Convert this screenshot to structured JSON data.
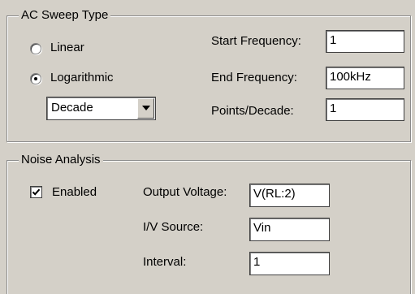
{
  "ac_sweep": {
    "title": "AC Sweep Type",
    "linear_label": "Linear",
    "logarithmic_label": "Logarithmic",
    "selected": "Logarithmic",
    "scale_value": "Decade",
    "start_frequency_label": "Start Frequency:",
    "start_frequency_value": "1",
    "end_frequency_label": "End Frequency:",
    "end_frequency_value": "100kHz",
    "points_label": "Points/Decade:",
    "points_value": "1"
  },
  "noise": {
    "title": "Noise Analysis",
    "enabled_label": "Enabled",
    "enabled_checked": true,
    "output_voltage_label": "Output Voltage:",
    "output_voltage_value": "V(RL:2)",
    "source_label": "I/V Source:",
    "source_value": "Vin",
    "interval_label": "Interval:",
    "interval_value": "1"
  }
}
